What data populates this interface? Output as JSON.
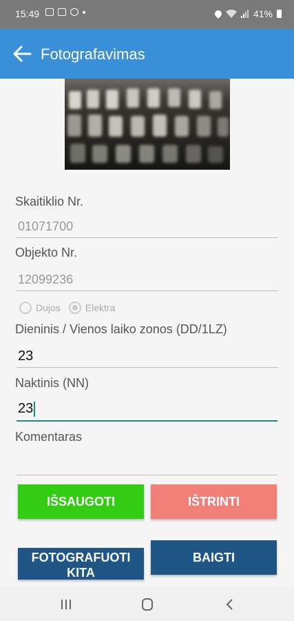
{
  "status_bar": {
    "time": "15:49",
    "battery": "41%"
  },
  "app_bar": {
    "title": "Fotografavimas"
  },
  "form": {
    "meter_label": "Skaitiklio Nr.",
    "meter_value": "01071700",
    "object_label": "Objekto Nr.",
    "object_value": "12099236",
    "radio_gas": "Dujos",
    "radio_electricity": "Elektra",
    "day_label": "Dieninis / Vienos laiko zonos (DD/1LZ)",
    "day_value": "23",
    "night_label": "Naktinis (NN)",
    "night_value": "23",
    "comment_label": "Komentaras",
    "comment_value": ""
  },
  "buttons": {
    "save": "IŠSAUGOTI",
    "delete": "IŠTRINTI",
    "photo_other": "FOTOGRAFUOTI KITA",
    "finish": "BAIGTI"
  },
  "colors": {
    "app_bar": "#3a8fd9",
    "save": "#33cc14",
    "delete": "#f07f78",
    "primary_dark": "#1f5587",
    "focus": "#1b8a7c"
  }
}
